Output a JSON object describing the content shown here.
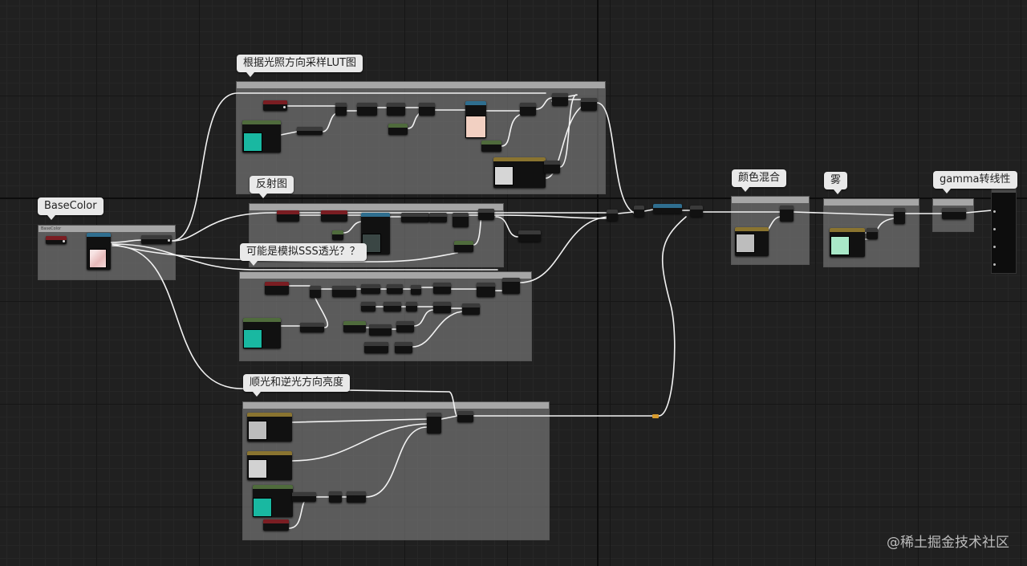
{
  "canvas": {
    "grid": "on",
    "background": "#202020"
  },
  "comments": {
    "basecolor": {
      "bubble": "BaseColor",
      "bar": "BaseColor"
    },
    "lut": {
      "bubble": "根据光照方向采样LUT图"
    },
    "reflection": {
      "bubble": "反射图"
    },
    "sss": {
      "bubble": "可能是模拟SSS透光？？"
    },
    "front_back": {
      "bubble": "顺光和逆光方向亮度"
    },
    "color_blend": {
      "bubble": "颜色混合"
    },
    "fog": {
      "bubble": "雾"
    },
    "gamma": {
      "bubble": "gamma转线性"
    }
  },
  "colors": {
    "teal_swatch": "#19b8a1",
    "peach_swatch": "#f2d0c2",
    "gray_swatch": "#bdbdbd",
    "mint_swatch": "#a9e8c8",
    "wire": "#f2f2f2",
    "reroute": "#d79b2e"
  },
  "watermark": "@稀土掘金技术社区"
}
